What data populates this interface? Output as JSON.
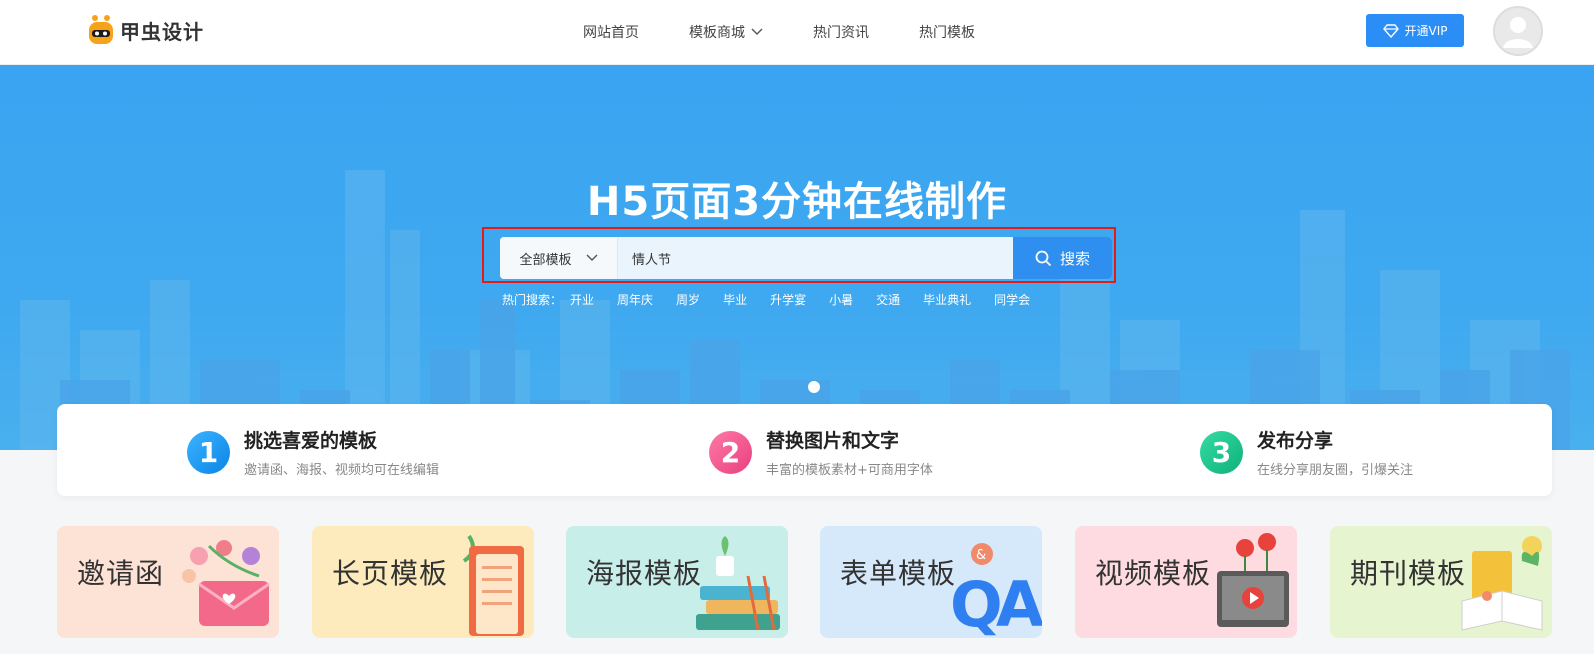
{
  "header": {
    "logo_text": "甲虫设计",
    "nav": [
      {
        "label": "网站首页"
      },
      {
        "label": "模板商城",
        "has_dropdown": true
      },
      {
        "label": "热门资讯"
      },
      {
        "label": "热门模板"
      }
    ],
    "vip_label": "开通VIP"
  },
  "banner": {
    "title": "H5页面3分钟在线制作",
    "search": {
      "category": "全部模板",
      "value": "情人节",
      "button_label": "搜索"
    },
    "hot_label": "热门搜索：",
    "hot_terms": [
      "开业",
      "周年庆",
      "周岁",
      "毕业",
      "升学宴",
      "小暑",
      "交通",
      "毕业典礼",
      "同学会"
    ]
  },
  "steps": [
    {
      "num": "1",
      "title": "挑选喜爱的模板",
      "desc": "邀请函、海报、视频均可在线编辑",
      "color": "#1a9af0"
    },
    {
      "num": "2",
      "title": "替换图片和文字",
      "desc": "丰富的模板素材+可商用字体",
      "color": "#f0508a"
    },
    {
      "num": "3",
      "title": "发布分享",
      "desc": "在线分享朋友圈，引爆关注",
      "color": "#1bc58d"
    }
  ],
  "categories": [
    {
      "label": "邀请函",
      "bg": "#fde2d6"
    },
    {
      "label": "长页模板",
      "bg": "#fdebbd"
    },
    {
      "label": "海报模板",
      "bg": "#c8eeea"
    },
    {
      "label": "表单模板",
      "bg": "#d6e9fb"
    },
    {
      "label": "视频模板",
      "bg": "#fddbe0"
    },
    {
      "label": "期刊模板",
      "bg": "#e6f5cf"
    }
  ],
  "colors": {
    "accent": "#2b8ef6",
    "banner_bg": "#3aa4f2",
    "highlight_outline": "#e21b1b"
  }
}
